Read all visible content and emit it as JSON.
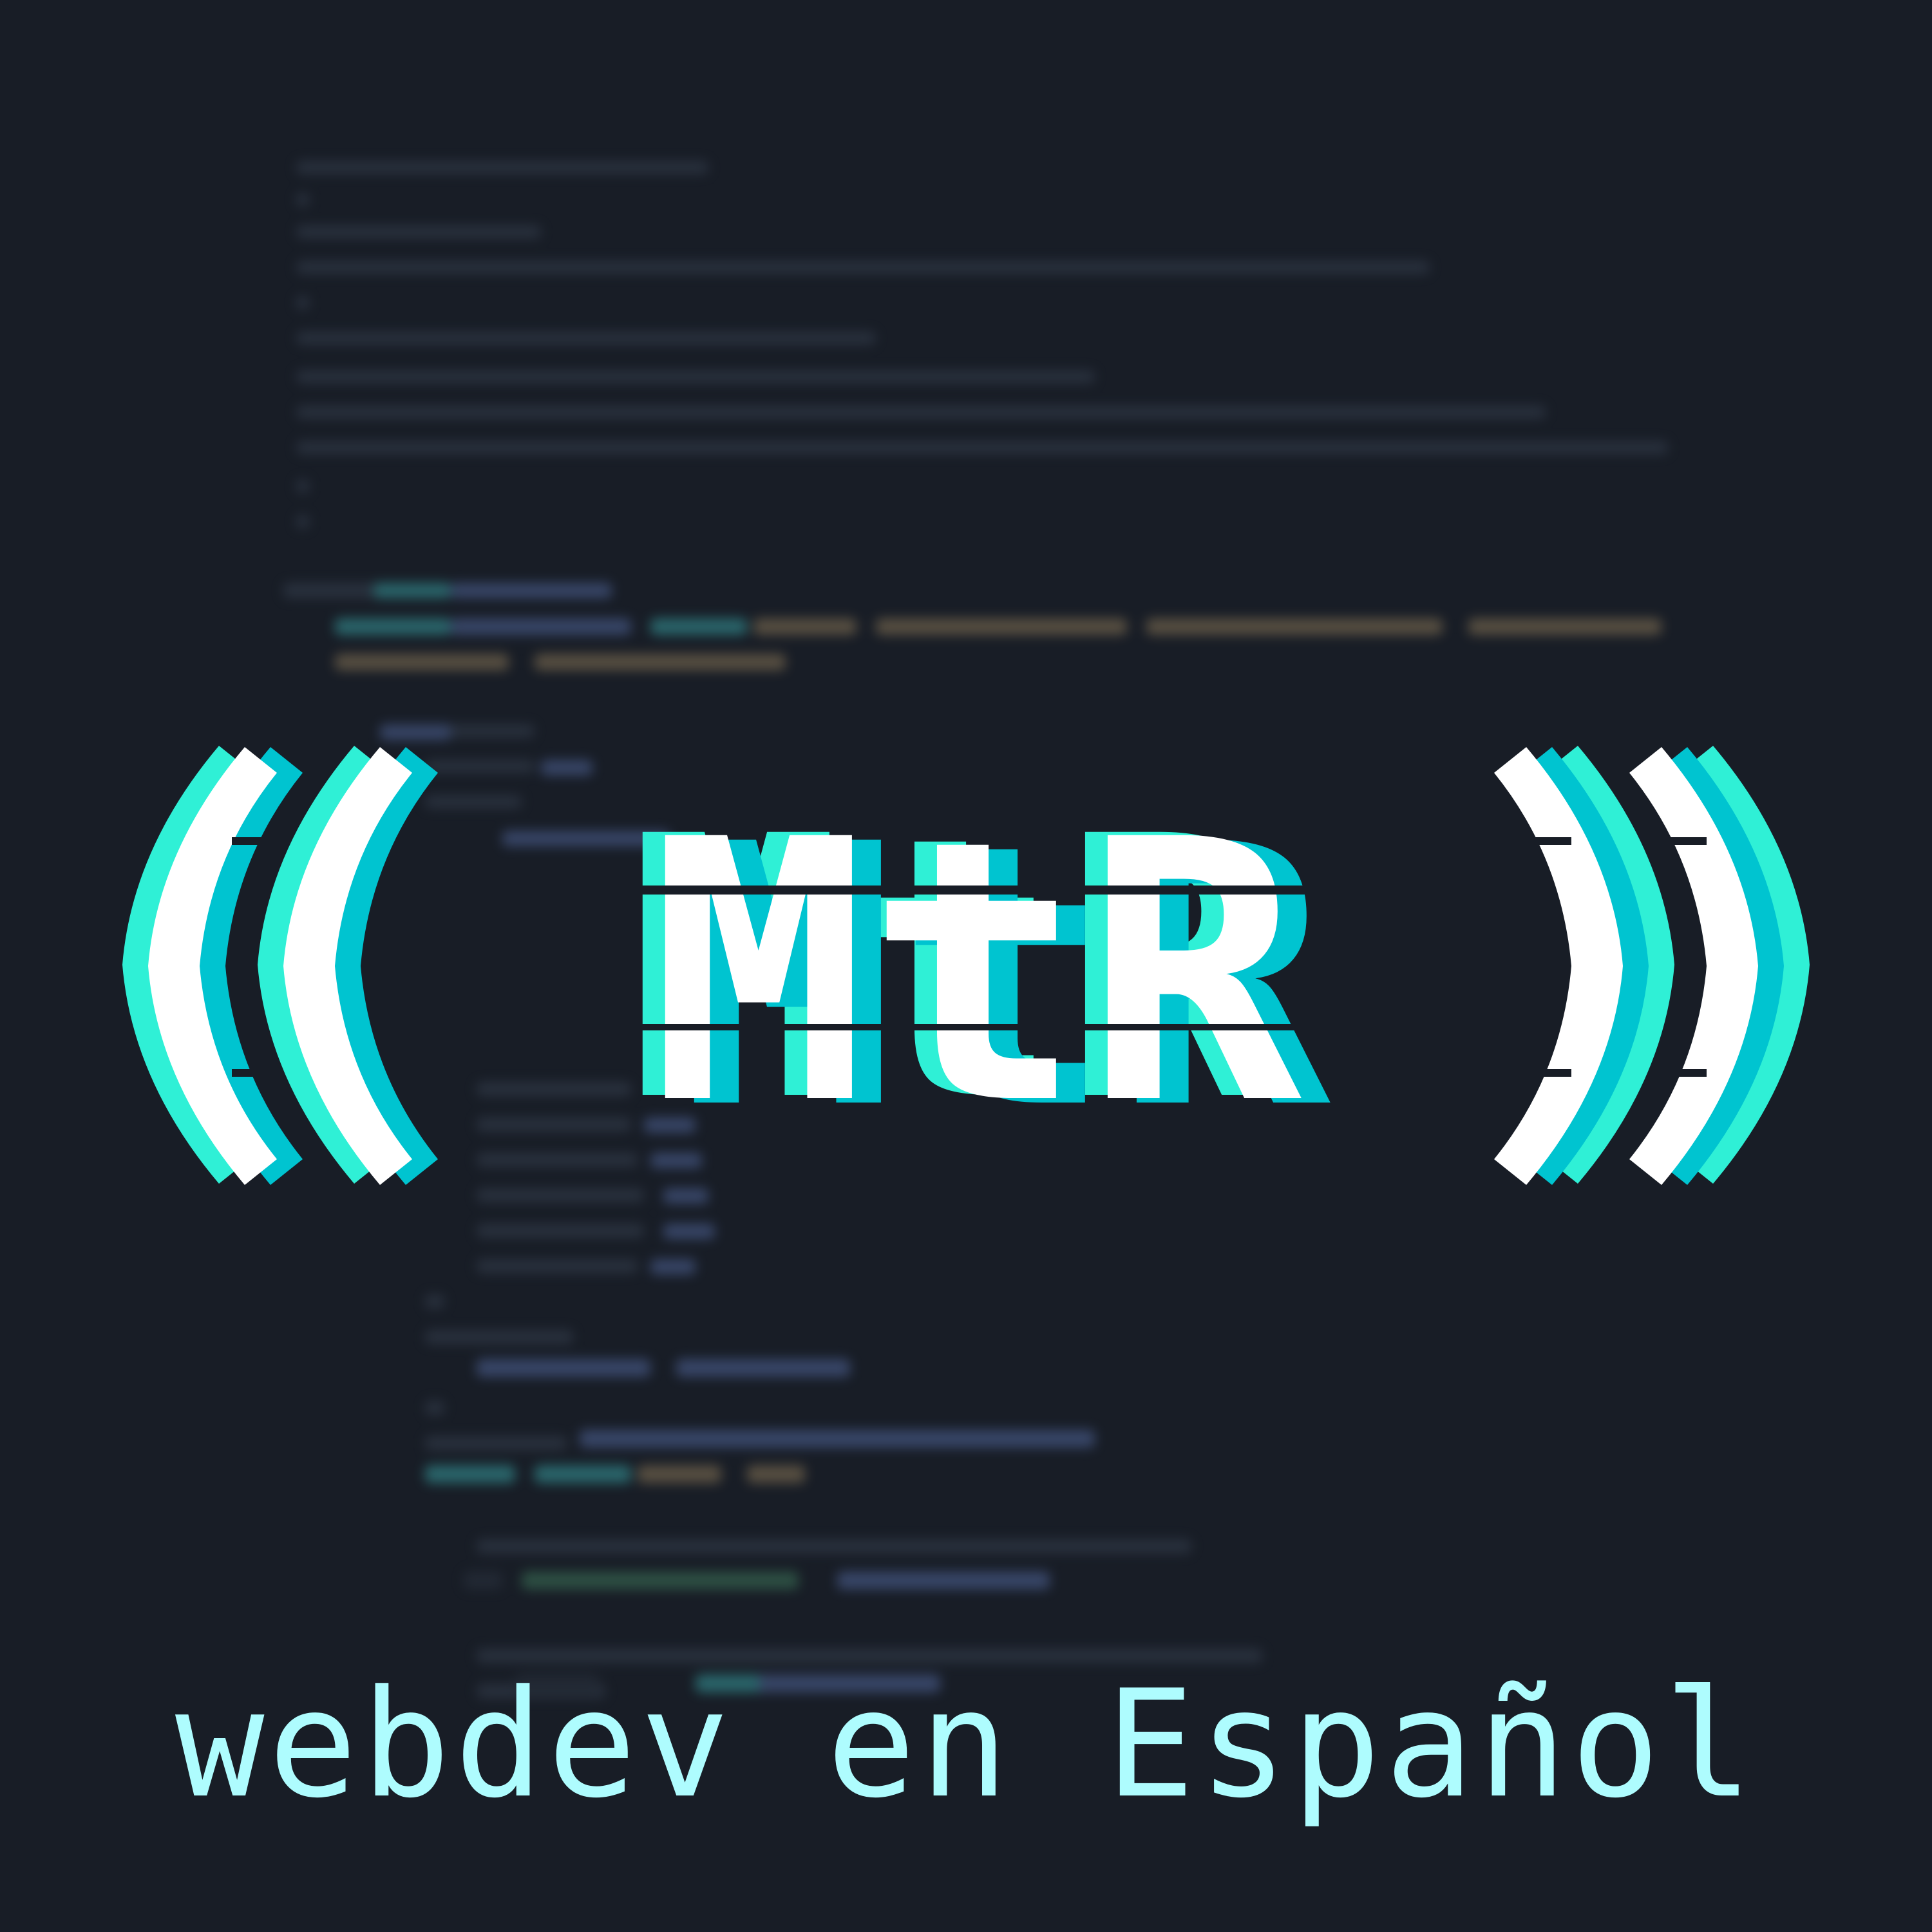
{
  "cover": {
    "logo_text": "MtR",
    "tagline": "webdev en Español"
  },
  "colors": {
    "background": "#181d26",
    "logo_face": "#ffffff",
    "logo_shadow_cyan": "#00c4d0",
    "logo_shadow_aqua": "#2ff0d6",
    "tagline": "#aefcfe",
    "code_blue": "#3b4a6e",
    "code_teal": "#2c6d72",
    "code_brown": "#5e5444",
    "code_green": "#2f5446",
    "code_gray": "#2b3340"
  },
  "icons": {
    "left_brackets": "double-open-parenthesis",
    "right_brackets": "double-close-parenthesis"
  }
}
